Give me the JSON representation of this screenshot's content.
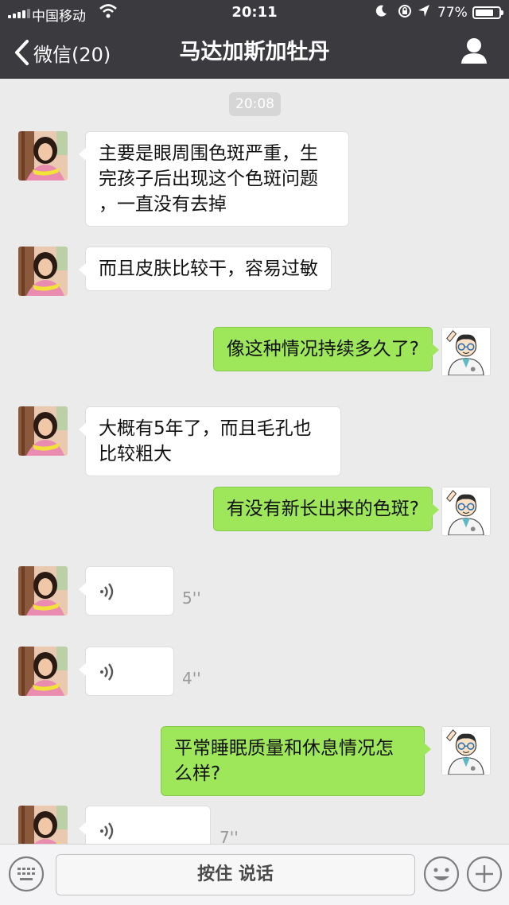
{
  "status_bar": {
    "carrier": "中国移动",
    "time": "20:11",
    "battery_percent": "77%",
    "battery_level": 0.77,
    "icons": [
      "signal-icon",
      "wifi-icon",
      "moon-icon",
      "orientation-lock-icon",
      "location-icon",
      "battery-icon"
    ]
  },
  "nav": {
    "back_label": "微信(20)",
    "title": "马达加斯加牡丹",
    "back_icon": "chevron-left-icon",
    "profile_icon": "user-icon"
  },
  "chat": {
    "timestamp": "20:08",
    "messages": [
      {
        "from": "contact",
        "type": "text",
        "text": "主要是眼周围色斑严重，生\n完孩子后出现这个色斑问题\n，一直没有去掉"
      },
      {
        "from": "contact",
        "type": "text",
        "text": "而且皮肤比较干，容易过敏"
      },
      {
        "from": "me",
        "type": "text",
        "text": "像这种情况持续多久了?"
      },
      {
        "from": "contact",
        "type": "text",
        "text": "大概有5年了，而且毛孔也\n比较粗大"
      },
      {
        "from": "me",
        "type": "text",
        "text": "有没有新长出来的色斑?"
      },
      {
        "from": "contact",
        "type": "voice",
        "duration": "5''"
      },
      {
        "from": "contact",
        "type": "voice",
        "duration": "4''"
      },
      {
        "from": "me",
        "type": "text",
        "text": "平常睡眠质量和休息情况怎\n么样?"
      },
      {
        "from": "contact",
        "type": "voice",
        "duration": "7''"
      }
    ]
  },
  "input_bar": {
    "hold_to_talk": "按住 说话",
    "icons": [
      "keyboard-icon",
      "emoji-icon",
      "plus-icon"
    ]
  },
  "colors": {
    "topbar": "#3a3a3f",
    "chat_bg": "#ebebeb",
    "outgoing_bubble": "#9ee75a",
    "incoming_bubble": "#ffffff"
  }
}
